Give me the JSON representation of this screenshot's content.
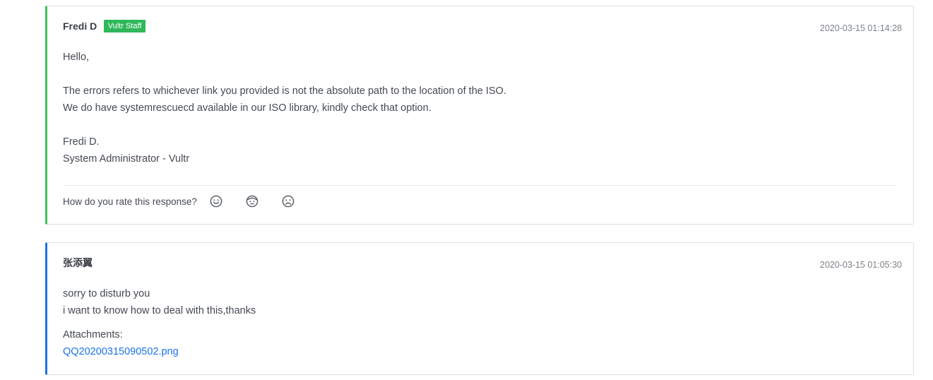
{
  "messages": [
    {
      "author": "Fredi D",
      "badge": "Vultr Staff",
      "timestamp": "2020-03-15 01:14:28",
      "lines": [
        "Hello,",
        "",
        "The errors refers to whichever link you provided is not the absolute path to the location of the ISO.",
        "We do have systemrescuecd available in our ISO library, kindly check that option.",
        "",
        "Fredi D.",
        "System Administrator - Vultr"
      ],
      "rating": {
        "prompt": "How do you rate this response?",
        "options": [
          "happy-face-icon",
          "neutral-face-icon",
          "sad-face-icon"
        ]
      },
      "accent_color": "#3cc35a"
    },
    {
      "author": "张添翼",
      "timestamp": "2020-03-15 01:05:30",
      "lines": [
        "sorry to disturb you",
        "i want to know how to deal with this,thanks"
      ],
      "attachments_label": "Attachments:",
      "attachments": [
        "QQ20200315090502.png"
      ],
      "accent_color": "#1a73e8"
    }
  ],
  "colors": {
    "badge": "#2fb85a",
    "link": "#1a73e8",
    "text": "#444a52",
    "timestamp": "#7c828a"
  }
}
